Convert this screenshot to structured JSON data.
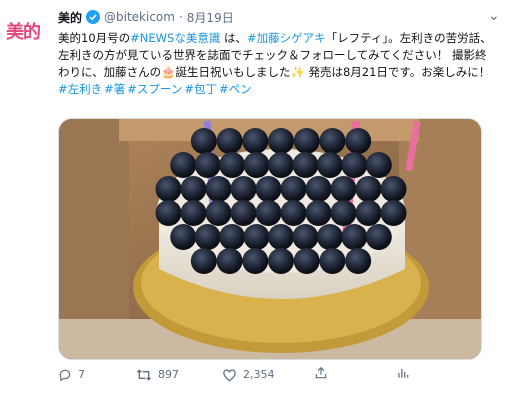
{
  "account": {
    "avatar_text": "美的",
    "display_name": "美的",
    "handle": "@bitekicom",
    "separator": "·",
    "date": "8月19日",
    "verified": true
  },
  "tweet": {
    "segments": [
      {
        "text": "美的10月号の",
        "link": false
      },
      {
        "text": "#NEWSな美意識",
        "link": true
      },
      {
        "text": " は、",
        "link": false
      },
      {
        "text": "#加藤シゲアキ",
        "link": true
      },
      {
        "text": "「レフティ」。左利きの苦労話、左利きの方が見ている世界を誌面でチェック＆フォローしてみてください！ 撮影終わりに、加藤さんの",
        "link": false
      },
      {
        "text": "🎂",
        "link": false
      },
      {
        "text": "誕生日祝いもしました",
        "link": false
      },
      {
        "text": "✨",
        "link": false
      },
      {
        "text": " 発売は8月21日です。お楽しみに！",
        "link": false
      }
    ],
    "hashtags": [
      "#左利き",
      "#箸",
      "#スプーン",
      "#包丁",
      "#ペン"
    ]
  },
  "photo": {
    "subject": "blueberry-cake-with-candles"
  },
  "actions": {
    "reply_count": "7",
    "retweet_count": "897",
    "like_count": "2,354"
  },
  "colors": {
    "link": "#1b95e0",
    "muted": "#5b7083",
    "brand": "#e8457a",
    "verified": "#1da1f2"
  }
}
